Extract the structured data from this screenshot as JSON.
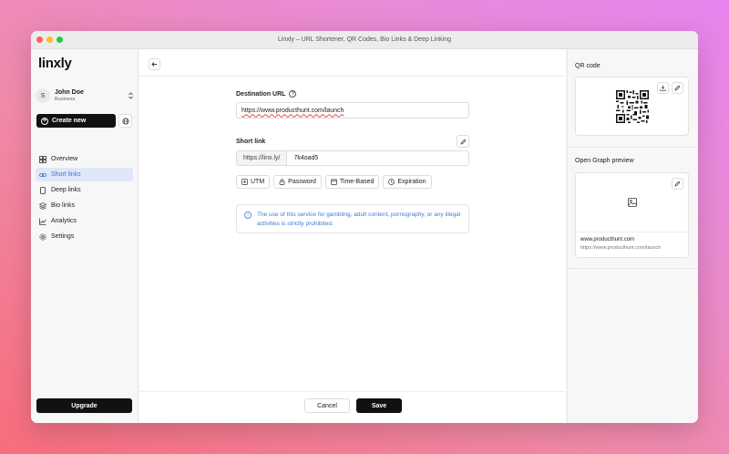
{
  "window": {
    "title": "Linxly – URL Shortener, QR Codes, Bio Links & Deep Linking"
  },
  "sidebar": {
    "logo": "linxly",
    "user": {
      "initial": "S",
      "name": "John Doe",
      "plan": "Business"
    },
    "create_label": "Create new",
    "items": [
      {
        "label": "Overview",
        "icon": "grid-icon"
      },
      {
        "label": "Short links",
        "icon": "link-icon",
        "active": true
      },
      {
        "label": "Deep links",
        "icon": "phone-icon"
      },
      {
        "label": "Bio links",
        "icon": "layers-icon"
      },
      {
        "label": "Analytics",
        "icon": "chart-icon"
      },
      {
        "label": "Settings",
        "icon": "gear-icon"
      }
    ],
    "upgrade_label": "Upgrade"
  },
  "form": {
    "destination_label": "Destination URL",
    "destination_value": "https://www.producthunt.com/launch",
    "short_label": "Short link",
    "short_prefix": "https://linx.ly/",
    "short_slug": "7k4oad5",
    "options": [
      "UTM",
      "Password",
      "Time-Based",
      "Expiration"
    ],
    "notice": "The use of this service for gambling, adult content, pornography, or any illegal activities is strictly prohibited."
  },
  "footer": {
    "cancel_label": "Cancel",
    "save_label": "Save"
  },
  "right": {
    "qr_label": "QR code",
    "og_label": "Open Graph preview",
    "og_domain": "www.producthunt.com",
    "og_url": "https://www.producthunt.com/launch"
  },
  "colors": {
    "accent": "#3b74d6",
    "active_bg": "#dfe8f7",
    "primary_button": "#111111"
  }
}
